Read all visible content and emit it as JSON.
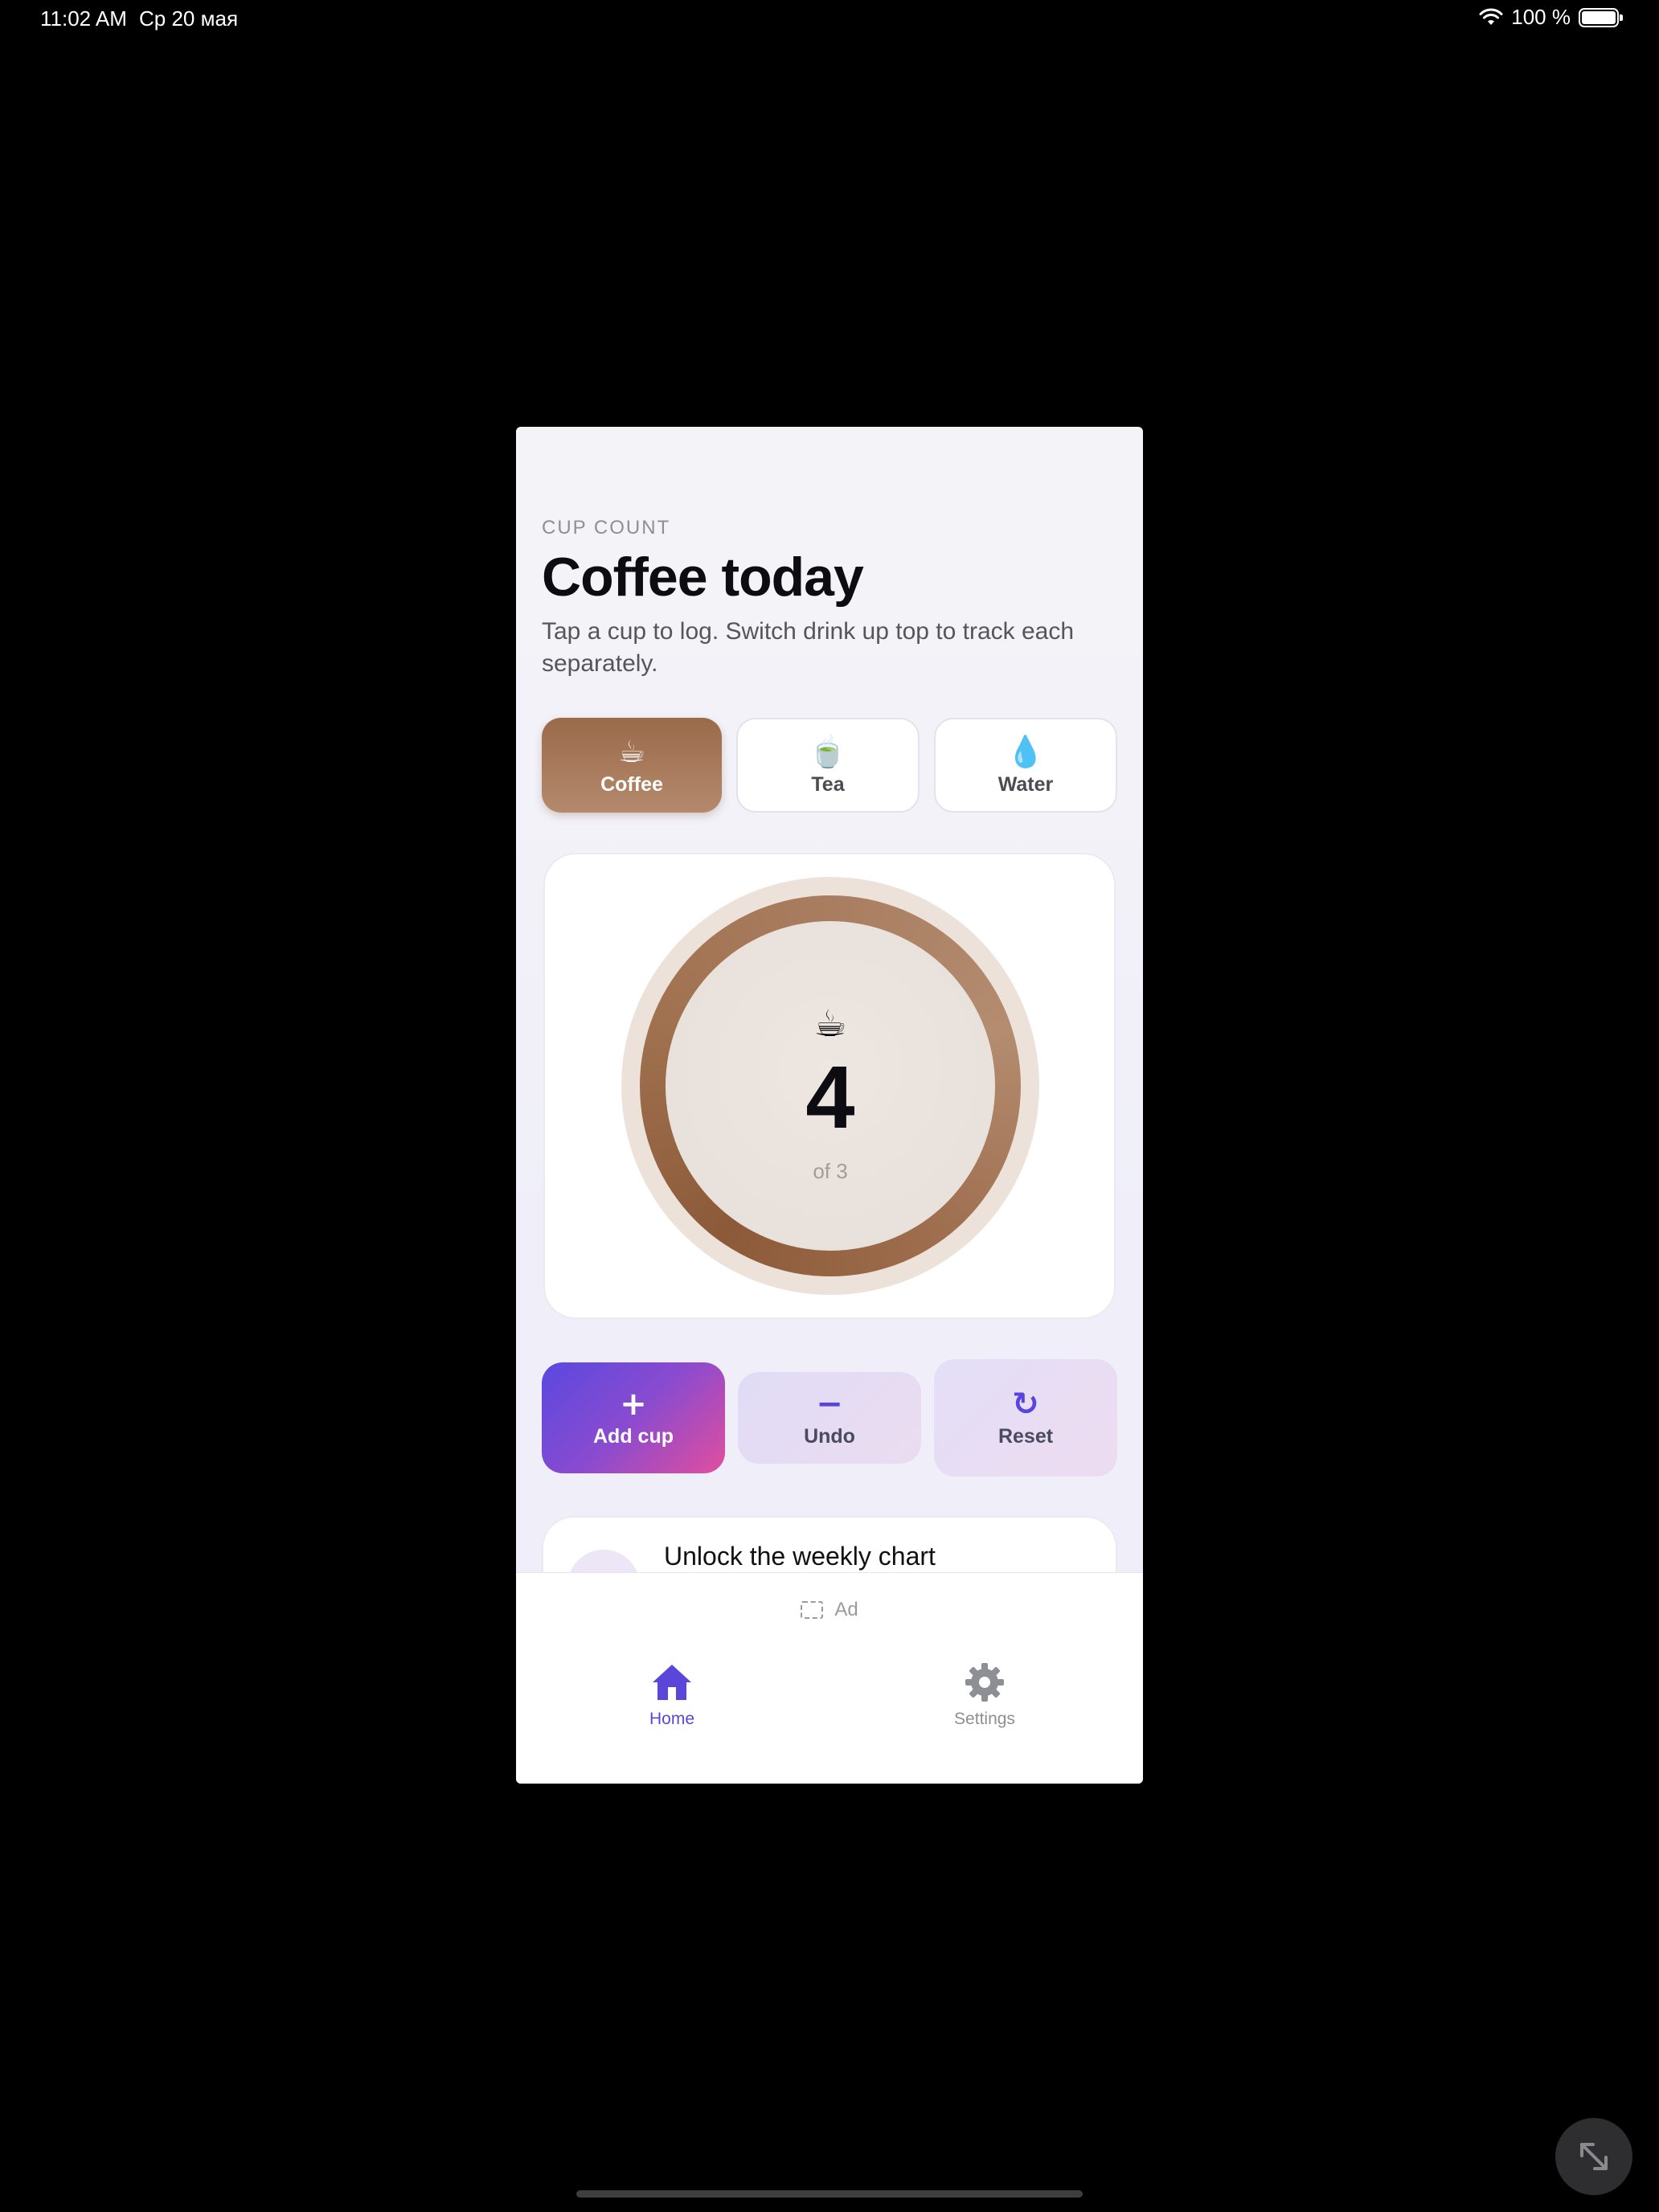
{
  "status_bar": {
    "time": "11:02 AM",
    "date": "Ср 20 мая",
    "battery": "100 %",
    "icons": [
      "wifi-icon",
      "battery-icon"
    ]
  },
  "header": {
    "eyebrow": "CUP COUNT",
    "title": "Coffee today",
    "subtitle": "Tap a cup to log. Switch drink up top to track each separately."
  },
  "drinks": [
    {
      "icon": "☕",
      "label": "Coffee",
      "selected": true
    },
    {
      "icon": "🍵",
      "label": "Tea",
      "selected": false
    },
    {
      "icon": "💧",
      "label": "Water",
      "selected": false
    }
  ],
  "counter": {
    "icon": "☕",
    "count": "4",
    "goal_text": "of 3",
    "progress": 1.0
  },
  "actions": {
    "add": {
      "icon": "+",
      "label": "Add cup"
    },
    "undo": {
      "icon": "−",
      "label": "Undo"
    },
    "reset": {
      "icon": "↻",
      "label": "Reset"
    }
  },
  "promo": {
    "title": "Unlock the weekly chart"
  },
  "ad": {
    "label": "Ad"
  },
  "nav": {
    "home": "Home",
    "settings": "Settings"
  },
  "colors": {
    "accent": "#5a46d8",
    "coffee": "#9a6a4a",
    "add_gradient_start": "#5a48e0",
    "add_gradient_end": "#e24e9e"
  }
}
